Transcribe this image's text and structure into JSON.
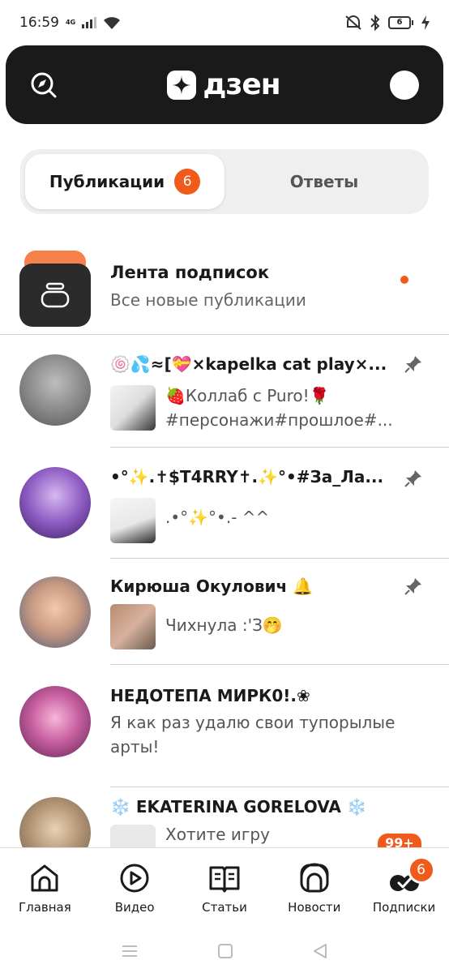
{
  "status_bar": {
    "time": "16:59",
    "network": "4G",
    "battery": "6"
  },
  "header": {
    "logo_text": "дзен"
  },
  "tabs": [
    {
      "label": "Публикации",
      "badge": "6",
      "active": true
    },
    {
      "label": "Ответы",
      "active": false
    }
  ],
  "feed": {
    "title": "Лента подписок",
    "subtitle": "Все новые публикации"
  },
  "channels": [
    {
      "name": "🍥💦≈[💝×kapelka cat play×...",
      "preview": "🍓Коллаб с Puro!🌹 #персонажи#прошлое#...",
      "pinned": true
    },
    {
      "name": "•°✨.✝$T4RRY✝.✨°•#За_Ла...",
      "preview": ".•°✨°•.- ^^",
      "pinned": true
    },
    {
      "name": "Кирюша Окулович 🔔",
      "preview": "Чихнула :'З🤭",
      "pinned": true
    },
    {
      "name": "НЕДОТЕПА МИРК0!.❀",
      "preview": "Я как раз удалю свои тупорылые арты!",
      "pinned": false
    },
    {
      "name": "❄️ EKATERINA GORELOVA ❄️",
      "preview": "Хотите игру",
      "pinned": false
    }
  ],
  "more_badge": "99+",
  "bottom_nav": [
    {
      "label": "Главная",
      "icon": "home-icon"
    },
    {
      "label": "Видео",
      "icon": "video-icon"
    },
    {
      "label": "Статьи",
      "icon": "articles-icon"
    },
    {
      "label": "Новости",
      "icon": "news-icon"
    },
    {
      "label": "Подписки",
      "icon": "subscriptions-icon",
      "badge": "6"
    }
  ],
  "colors": {
    "accent": "#f05a1a",
    "header_bg": "#1a1a1a"
  }
}
